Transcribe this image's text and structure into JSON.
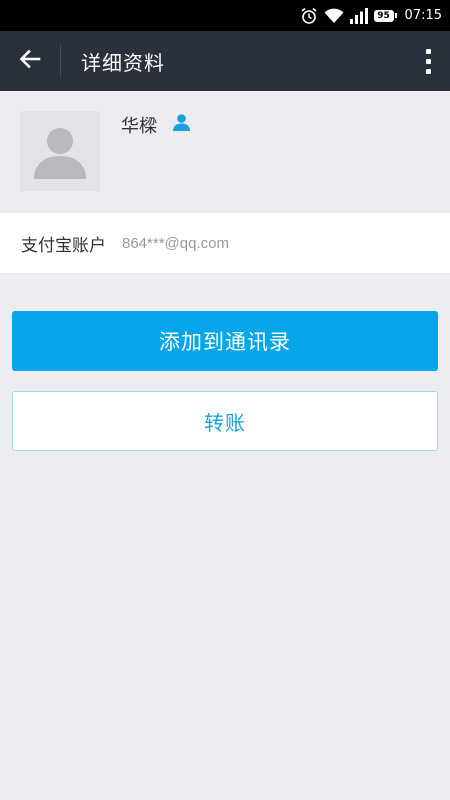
{
  "status_bar": {
    "time": "07:15",
    "battery": "95",
    "icons": [
      "alarm-icon",
      "wifi-icon",
      "signal-icon",
      "battery-icon"
    ]
  },
  "app_bar": {
    "title": "详细资料",
    "back_icon": "arrow-left-icon",
    "menu_icon": "more-vertical-icon"
  },
  "profile": {
    "name": "华樑",
    "avatar_icon": "default-avatar-icon",
    "badge_icon": "contact-person-icon"
  },
  "account": {
    "label": "支付宝账户",
    "value": "864***@qq.com"
  },
  "actions": {
    "add_contact_label": "添加到通讯录",
    "transfer_label": "转账"
  },
  "colors": {
    "app_bar_bg": "#2b303d",
    "primary_button": "#07a5ea",
    "secondary_text": "#1aa1df",
    "page_bg": "#ebedf1"
  }
}
